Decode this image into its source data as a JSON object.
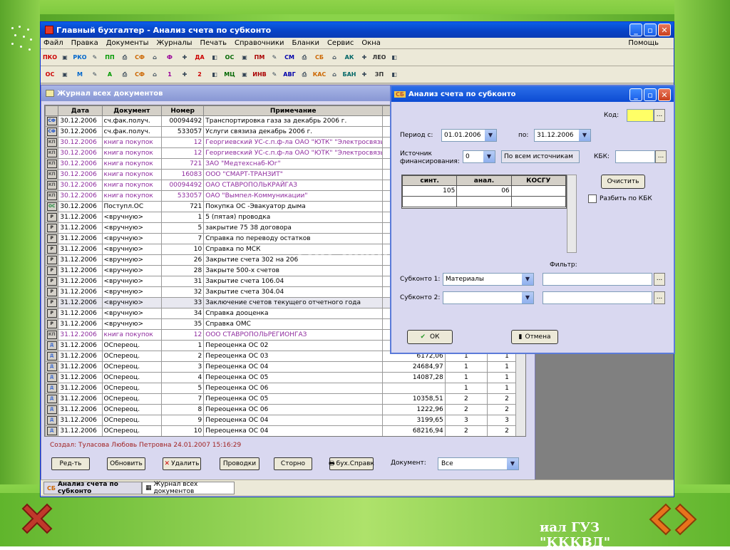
{
  "window": {
    "title": "Главный бухгалтер - Анализ счета по субконто",
    "menu": [
      "Файл",
      "Правка",
      "Документы",
      "Журналы",
      "Печать",
      "Справочники",
      "Бланки",
      "Сервис",
      "Окна"
    ],
    "help": "Помощь",
    "toolbar1": [
      "ПКО",
      "РКО",
      "ПП",
      "СФ",
      "Ф",
      "ДА",
      "ОС",
      "ПМ",
      "СМ",
      "СБ",
      "АК",
      "ЛЕО"
    ],
    "toolbar2": [
      "ОС",
      "М",
      "А",
      "СФ",
      "1",
      "2",
      "МЦ",
      "ИНВ",
      "АВГ",
      "КАС",
      "БАН",
      "ЗП"
    ]
  },
  "journal": {
    "title": "Журнал всех документов",
    "columns": [
      "Дата",
      "Документ",
      "Номер",
      "Примечание"
    ],
    "rows": [
      {
        "icon": "СФ",
        "date": "30.12.2006",
        "doc": "сч.фак.получ.",
        "num": "00094492",
        "note": "Транспортировка газа за декабрь 2006 г.",
        "style": ""
      },
      {
        "icon": "СФ",
        "date": "30.12.2006",
        "doc": "сч.фак.получ.",
        "num": "533057",
        "note": "Услуги связиза декабрь 2006 г.",
        "style": ""
      },
      {
        "icon": "КП",
        "date": "30.12.2006",
        "doc": "книга покупок",
        "num": "12",
        "note": "Георгиевский УС-с.п.ф-ла ОАО \"ЮТК\" \"Электросвязь",
        "style": "purple"
      },
      {
        "icon": "КП",
        "date": "30.12.2006",
        "doc": "книга покупок",
        "num": "12",
        "note": "Георгиевский УС-с.п.ф-ла ОАО \"ЮТК\" \"Электросвязь",
        "style": "purple"
      },
      {
        "icon": "КП",
        "date": "30.12.2006",
        "doc": "книга покупок",
        "num": "721",
        "note": "ЗАО \"Медтехснаб-Юг\"",
        "style": "purple"
      },
      {
        "icon": "КП",
        "date": "30.12.2006",
        "doc": "книга покупок",
        "num": "16083",
        "note": "ООО \"СМАРТ-ТРАНЗИТ\"",
        "style": "purple"
      },
      {
        "icon": "КП",
        "date": "30.12.2006",
        "doc": "книга покупок",
        "num": "00094492",
        "note": "ОАО СТАВРОПОЛЬКРАЙГАЗ",
        "style": "purple"
      },
      {
        "icon": "КП",
        "date": "30.12.2006",
        "doc": "книга покупок",
        "num": "533057",
        "note": "ОАО \"Вымпел-Коммуникации\"",
        "style": "purple"
      },
      {
        "icon": "ОС",
        "date": "30.12.2006",
        "doc": "Поступл.ОС",
        "num": "721",
        "note": "Покупка ОС  -Эвакуатор дыма",
        "style": ""
      },
      {
        "icon": "Р",
        "date": "31.12.2006",
        "doc": "<вручную>",
        "num": "1",
        "note": "5 (пятая) проводка",
        "style": ""
      },
      {
        "icon": "Р",
        "date": "31.12.2006",
        "doc": "<вручную>",
        "num": "5",
        "note": "закрытие 75 38 договора",
        "style": ""
      },
      {
        "icon": "Р",
        "date": "31.12.2006",
        "doc": "<вручную>",
        "num": "7",
        "note": "Справка  по переводу остатков",
        "style": ""
      },
      {
        "icon": "Р",
        "date": "31.12.2006",
        "doc": "<вручную>",
        "num": "10",
        "note": "Справка по МСК",
        "style": ""
      },
      {
        "icon": "Р",
        "date": "31.12.2006",
        "doc": "<вручную>",
        "num": "26",
        "note": "Закрытие счета 302 на 206",
        "style": ""
      },
      {
        "icon": "Р",
        "date": "31.12.2006",
        "doc": "<вручную>",
        "num": "28",
        "note": "Закрыте 500-х счетов",
        "style": ""
      },
      {
        "icon": "Р",
        "date": "31.12.2006",
        "doc": "<вручную>",
        "num": "31",
        "note": "Закрытие счета 106.04",
        "style": ""
      },
      {
        "icon": "Р",
        "date": "31.12.2006",
        "doc": "<вручную>",
        "num": "32",
        "note": "Закрытие счета 304.04",
        "style": ""
      },
      {
        "icon": "Р",
        "date": "31.12.2006",
        "doc": "<вручную>",
        "num": "33",
        "note": "Заключение счетов текущего отчетного года",
        "style": "sel"
      },
      {
        "icon": "Р",
        "date": "31.12.2006",
        "doc": "<вручную>",
        "num": "34",
        "note": "Справка дооценка",
        "style": ""
      },
      {
        "icon": "Р",
        "date": "31.12.2006",
        "doc": "<вручную>",
        "num": "35",
        "note": "Справка  ОМС",
        "style": ""
      },
      {
        "icon": "КП",
        "date": "31.12.2006",
        "doc": "книга покупок",
        "num": "12",
        "note": "ООО СТАВРОПОЛЬРЕГИОНГАЗ",
        "style": "purple"
      },
      {
        "icon": "Д",
        "date": "31.12.2006",
        "doc": "ОСпереоц.",
        "num": "1",
        "note": "Переоценка ОС  02",
        "style": ""
      },
      {
        "icon": "Д",
        "date": "31.12.2006",
        "doc": "ОСпереоц.",
        "num": "2",
        "note": "Переоценка ОС  03",
        "style": ""
      },
      {
        "icon": "Д",
        "date": "31.12.2006",
        "doc": "ОСпереоц.",
        "num": "3",
        "note": "Переоценка ОС 04",
        "style": ""
      },
      {
        "icon": "Д",
        "date": "31.12.2006",
        "doc": "ОСпереоц.",
        "num": "4",
        "note": "Переоценка ОС  05",
        "style": ""
      },
      {
        "icon": "Д",
        "date": "31.12.2006",
        "doc": "ОСпереоц.",
        "num": "5",
        "note": "Переоценка ОС  06",
        "style": ""
      },
      {
        "icon": "Д",
        "date": "31.12.2006",
        "doc": "ОСпереоц.",
        "num": "7",
        "note": "Переоценка ОС  05",
        "style": ""
      },
      {
        "icon": "Д",
        "date": "31.12.2006",
        "doc": "ОСпереоц.",
        "num": "8",
        "note": "Переоценка ОС  06",
        "style": ""
      },
      {
        "icon": "Д",
        "date": "31.12.2006",
        "doc": "ОСпереоц.",
        "num": "9",
        "note": "Переоценка ОС  04",
        "style": ""
      },
      {
        "icon": "Д",
        "date": "31.12.2006",
        "doc": "ОСпереоц.",
        "num": "10",
        "note": "Переоценка ОС  04",
        "style": ""
      }
    ],
    "extra_rows": [
      {
        "amount": "6172,06",
        "a": "1",
        "b": "1"
      },
      {
        "amount": "24684,97",
        "a": "1",
        "b": "1"
      },
      {
        "amount": "14087,28",
        "a": "1",
        "b": "1"
      },
      {
        "amount": "",
        "a": "1",
        "b": "1"
      },
      {
        "amount": "10358,51",
        "a": "2",
        "b": "2"
      },
      {
        "amount": "1222,96",
        "a": "2",
        "b": "2"
      },
      {
        "amount": "3199,65",
        "a": "3",
        "b": "3"
      },
      {
        "amount": "68216,94",
        "a": "2",
        "b": "2"
      }
    ],
    "author": "Создал: Туласова Любовь Петровна 24.01.2007 15:16:29",
    "buttons": {
      "edit": "Ред-ть",
      "refresh": "Обновить",
      "delete": "Удалить",
      "postings": "Проводки",
      "storno": "Сторно",
      "reference": "бух.Справк"
    },
    "doc_label": "Документ:",
    "doc_value": "Все"
  },
  "dialog": {
    "title": "Анализ счета по субконто",
    "title_badge": "СБ",
    "code_label": "Код:",
    "period_from_label": "Период с:",
    "period_from": "01.01.2006",
    "period_to_label": "по:",
    "period_to": "31.12.2006",
    "source_label": "Источник финансирования:",
    "source_value": "0",
    "source_desc": "По всем источникам",
    "kbk_label": "КБК:",
    "clear_button": "Очистить",
    "split_kbk": "Разбить по КБК",
    "grid_headers": [
      "синт.",
      "анал.",
      "КОСГУ"
    ],
    "grid_row": [
      "105",
      "06",
      ""
    ],
    "filter_label": "Фильтр:",
    "subkonto1_label": "Субконто 1:",
    "subkonto1_value": "Материалы",
    "subkonto2_label": "Субконто 2:",
    "subkonto2_value": "",
    "ok": "ОК",
    "cancel": "Отмена"
  },
  "taskbar": {
    "tab1": "Анализ счета по субконто",
    "tab2": "Журнал всех документов"
  },
  "watermark": "soft.mydiv.net",
  "background_text": "иал ГУЗ \"КККВД\""
}
